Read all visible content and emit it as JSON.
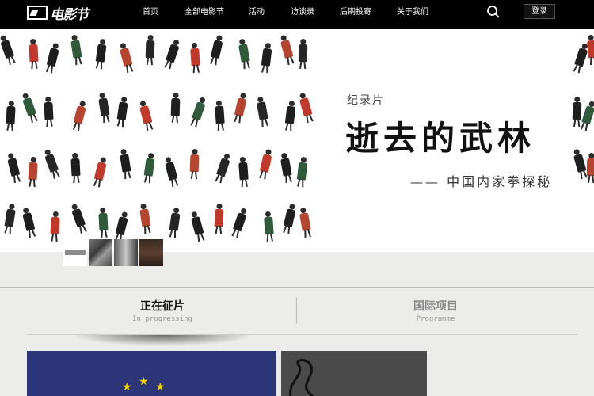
{
  "header": {
    "logo_text": "电影节",
    "nav": [
      "首页",
      "全部电影节",
      "活动",
      "访谈录",
      "后期投寄",
      "关于我们"
    ],
    "login_label": "登录",
    "search_icon": "search-icon"
  },
  "banner": {
    "doc_label": "纪录片",
    "title": "逝去的武林",
    "subtitle": "—— 中国内家拳探秘"
  },
  "tabs": [
    {
      "title": "正在征片",
      "subtitle": "In progressing",
      "active": true
    },
    {
      "title": "国际项目",
      "subtitle": "Programme",
      "active": false
    }
  ],
  "colors": {
    "accent_red": "#c0392b",
    "nav_bg": "#000000",
    "eu_blue": "#2c3577",
    "star_yellow": "#f5d300"
  }
}
